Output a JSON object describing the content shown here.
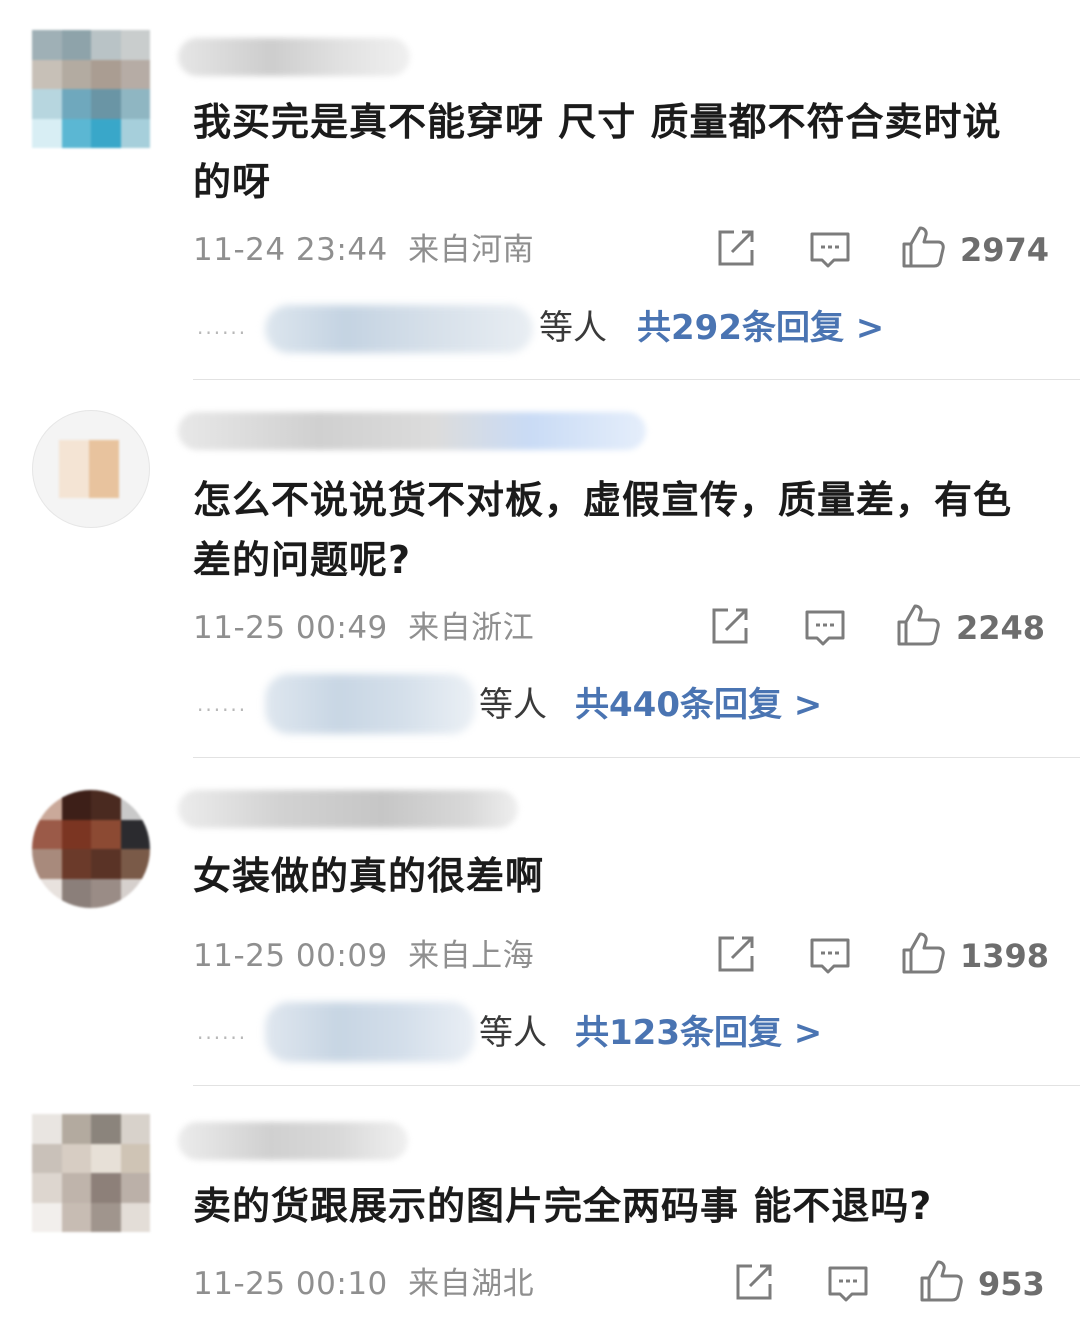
{
  "comments": [
    {
      "text": "我买完是真不能穿呀 尺寸 质量都不符合卖时说的呀",
      "time": "11-24 23:44",
      "location": "来自河南",
      "likes": "2974",
      "reply_suffix": "等人",
      "reply_total": "共292条回复 >"
    },
    {
      "text": "怎么不说说货不对板，虚假宣传，质量差，有色差的问题呢?",
      "time": "11-25 00:49",
      "location": "来自浙江",
      "likes": "2248",
      "reply_suffix": "等人",
      "reply_total": "共440条回复 >"
    },
    {
      "text": "女装做的真的很差啊",
      "time": "11-25 00:09",
      "location": "来自上海",
      "likes": "1398",
      "reply_suffix": "等人",
      "reply_total": "共123条回复 >"
    },
    {
      "text": "卖的货跟展示的图片完全两码事 能不退吗?",
      "time": "11-25 00:10",
      "location": "来自湖北",
      "likes": "953"
    }
  ],
  "reply_dots": "······",
  "icons": {
    "share": "share-icon",
    "comment": "comment-icon",
    "like": "thumbs-up-icon"
  },
  "colors": {
    "accent_link": "#4a74b2",
    "meta_gray": "#8f8f8f",
    "text": "#1b1b1b"
  }
}
